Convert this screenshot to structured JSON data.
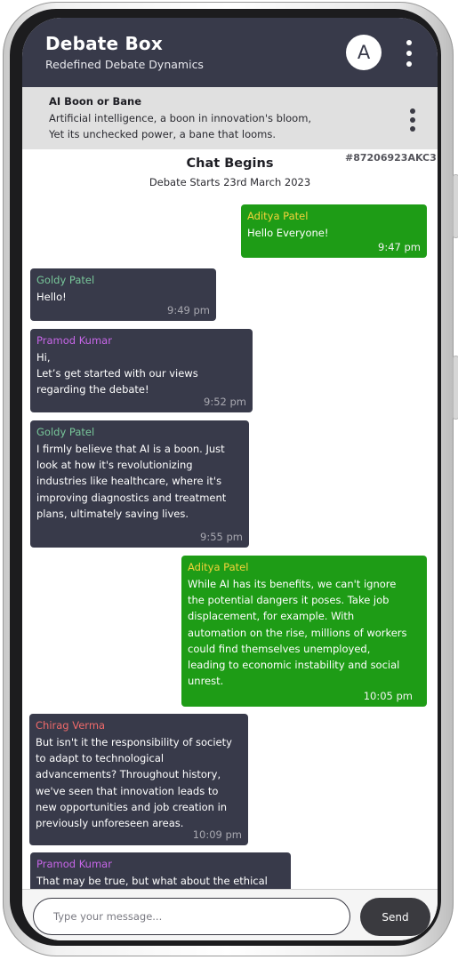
{
  "header": {
    "title": "Debate Box",
    "subtitle": "Redefined Debate Dynamics",
    "avatar_letter": "A"
  },
  "topic": {
    "title": "AI Boon or Bane",
    "line1": "Artificial intelligence, a boon in innovation's bloom,",
    "line2": "Yet its unchecked power, a bane that looms."
  },
  "chat": {
    "id": "#87206923AKC3",
    "heading": "Chat Begins",
    "subheading": "Debate Starts 23rd March 2023",
    "messages": [
      {
        "sender": "Aditya Patel",
        "text": "Hello Everyone!",
        "time": "9:47 pm",
        "direction": "sent"
      },
      {
        "sender": "Goldy Patel",
        "text": "Hello!",
        "time": "9:49 pm",
        "direction": "received"
      },
      {
        "sender": "Pramod Kumar",
        "text": "Hi,\nLet’s get started with our views\nregarding the debate!",
        "time": "9:52 pm",
        "direction": "received"
      },
      {
        "sender": "Goldy Patel",
        "text": "I firmly believe that AI is a boon. Just\nlook at how it's revolutionizing\nindustries like healthcare, where it's\nimproving diagnostics and treatment\nplans, ultimately saving lives.",
        "time": "9:55 pm",
        "direction": "received"
      },
      {
        "sender": "Aditya Patel",
        "text": "While AI has its benefits, we can't ignore\nthe potential dangers it poses. Take job\ndisplacement, for example. With\nautomation on the rise, millions of workers\ncould find themselves unemployed,\nleading to economic instability and social\nunrest.",
        "time": "10:05 pm",
        "direction": "sent"
      },
      {
        "sender": "Chirag Verma",
        "text": "But isn't it the responsibility of society\nto adapt to technological\nadvancements? Throughout history,\nwe've seen that innovation leads to\nnew opportunities and job creation in\npreviously unforeseen areas.",
        "time": "10:09 pm",
        "direction": "received"
      },
      {
        "sender": "Pramod Kumar",
        "text": "That may be true, but what about the ethical",
        "time": "",
        "direction": "received"
      }
    ]
  },
  "composer": {
    "placeholder": "Type your message...",
    "send_label": "Send"
  },
  "colors": {
    "header_bg": "#383a4a",
    "sent_bubble": "#1e9c16",
    "received_bubble": "#383a4a",
    "topic_bg": "#e0e0e0"
  }
}
